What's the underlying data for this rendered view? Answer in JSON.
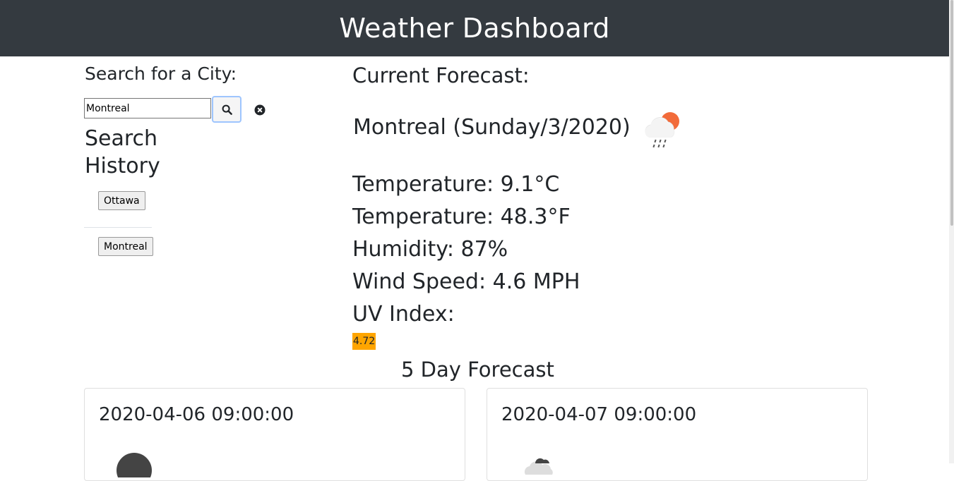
{
  "header": {
    "title": "Weather Dashboard"
  },
  "search": {
    "heading": "Search for a City:",
    "input_value": "Montreal",
    "button_icon": "search-icon",
    "clear_icon": "close-circle-icon"
  },
  "history": {
    "heading": "Search History",
    "items": [
      {
        "label": "Ottawa"
      },
      {
        "label": "Montreal"
      }
    ]
  },
  "current": {
    "heading": "Current Forecast:",
    "city_line": "Montreal (Sunday/3/2020)",
    "icon": "rain-cloud-sun-icon",
    "temperature_c": "Temperature: 9.1°C",
    "temperature_f": "Temperature: 48.3°F",
    "humidity": "Humidity: 87%",
    "wind": "Wind Speed: 4.6 MPH",
    "uv_label": "UV Index:",
    "uv_value": "4.72",
    "uv_color": "#ffa500"
  },
  "forecast": {
    "heading": "5 Day Forecast",
    "days": [
      {
        "date": "2020-04-06 09:00:00",
        "icon": "dark-cloud-icon"
      },
      {
        "date": "2020-04-07 09:00:00",
        "icon": "cloud-icon"
      }
    ]
  },
  "colors": {
    "header_bg": "#343a40",
    "accent_orange": "#f26b3a"
  }
}
